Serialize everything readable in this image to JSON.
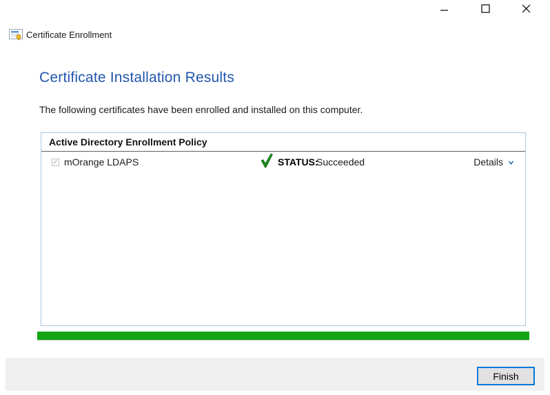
{
  "window": {
    "app_title": "Certificate Enrollment",
    "app_icon": "certificate-icon",
    "controls": [
      {
        "name": "minimize",
        "icon": "minimize-icon"
      },
      {
        "name": "maximize",
        "icon": "maximize-icon"
      },
      {
        "name": "close",
        "icon": "close-icon"
      }
    ]
  },
  "page": {
    "heading": "Certificate Installation Results",
    "description": "The following certificates have been enrolled and installed on this computer."
  },
  "results_panel": {
    "header": "Active Directory Enrollment Policy",
    "rows": [
      {
        "checkbox_checked": true,
        "checkbox_disabled": true,
        "check_glyph": "✓",
        "name": "mOrange LDAPS",
        "status_icon": "green-check-icon",
        "status_label": "STATUS:",
        "status_value": "Succeeded",
        "details_label": "Details",
        "details_icon": "chevron-down-icon"
      }
    ],
    "progress_percent": 100
  },
  "footer": {
    "finish_label": "Finish"
  },
  "colors": {
    "heading_blue": "#2156ac",
    "panel_border_blue": "#a9c7e3",
    "panel_header_rule": "#5f5f5f",
    "progress_green": "#12a412",
    "success_check_green": "#1e8a1e",
    "details_chevron_blue": "#1d5a9e",
    "finish_border_accent": "#0078d7",
    "footer_background": "#f0f0f0"
  }
}
